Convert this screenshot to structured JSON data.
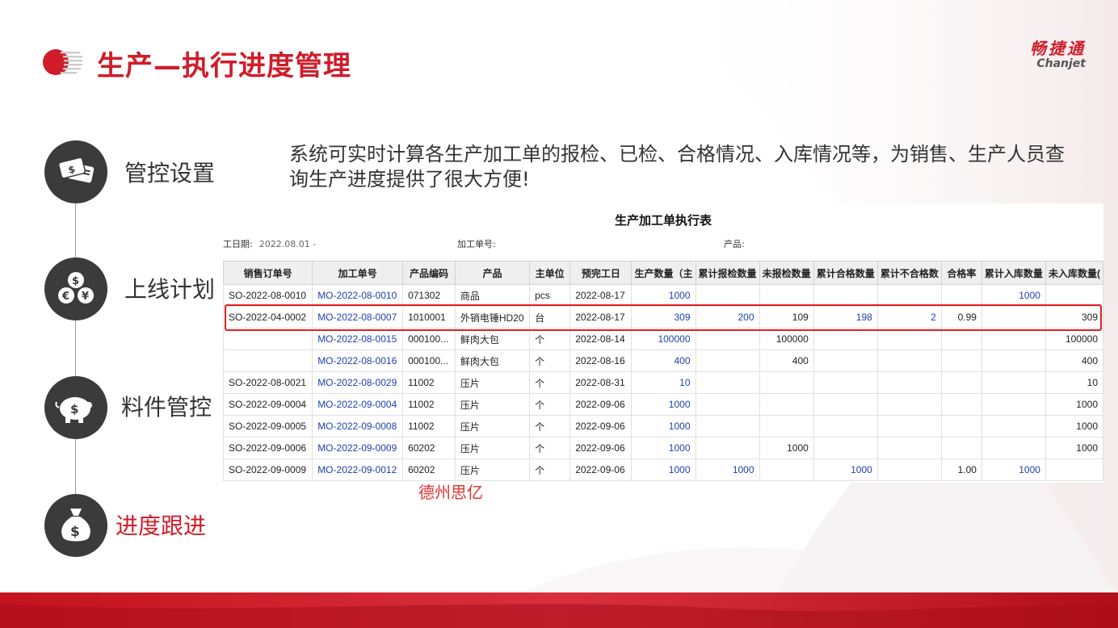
{
  "title": "生产—执行进度管理",
  "brand": {
    "name_cn": "畅捷通",
    "name_en": "Chanjet"
  },
  "colors": {
    "accent": "#d01c2a",
    "nav_circle": "#3b3b3b",
    "link": "#1f3fb0",
    "highlight": "#e02020"
  },
  "nav": [
    {
      "label": "管控设置",
      "icon": "credit-cards-icon",
      "active": false
    },
    {
      "label": "上线计划",
      "icon": "coins-icon",
      "active": false
    },
    {
      "label": "料件管控",
      "icon": "piggy-bank-icon",
      "active": false
    },
    {
      "label": "进度跟进",
      "icon": "money-bag-icon",
      "active": true
    }
  ],
  "description": "系统可实时计算各生产加工单的报检、已检、合格情况、入库情况等，为销售、生产人员查询生产进度提供了很大方便!",
  "report": {
    "title": "生产加工单执行表",
    "filters": [
      {
        "label": "工日期:",
        "value": "2022.08.01 -"
      },
      {
        "label": "加工单号:",
        "value": ""
      },
      {
        "label": "产品:",
        "value": ""
      }
    ],
    "columns": [
      "销售订单号",
      "加工单号",
      "产品编码",
      "产品",
      "主单位",
      "预完工日",
      "生产数量（主",
      "累计报检数量",
      "未报检数量",
      "累计合格数量",
      "累计不合格数",
      "合格率",
      "累计入库数量",
      "未入库数量("
    ],
    "rows": [
      [
        "SO-2022-08-0010",
        "MO-2022-08-0010",
        "071302",
        "商品",
        "pcs",
        "2022-08-17",
        "1000",
        "",
        "",
        "",
        "",
        "",
        "1000",
        ""
      ],
      [
        "SO-2022-04-0002",
        "MO-2022-08-0007",
        "1010001",
        "外销电锤HD20",
        "台",
        "2022-08-17",
        "309",
        "200",
        "109",
        "198",
        "2",
        "0.99",
        "",
        "309"
      ],
      [
        "",
        "MO-2022-08-0015",
        "000100...",
        "鲜肉大包",
        "个",
        "2022-08-14",
        "100000",
        "",
        "100000",
        "",
        "",
        "",
        "",
        "100000"
      ],
      [
        "",
        "MO-2022-08-0016",
        "000100...",
        "鲜肉大包",
        "个",
        "2022-08-16",
        "400",
        "",
        "400",
        "",
        "",
        "",
        "",
        "400"
      ],
      [
        "SO-2022-08-0021",
        "MO-2022-08-0029",
        "11002",
        "压片",
        "个",
        "2022-08-31",
        "10",
        "",
        "",
        "",
        "",
        "",
        "",
        "10"
      ],
      [
        "SO-2022-09-0004",
        "MO-2022-09-0004",
        "11002",
        "压片",
        "个",
        "2022-09-06",
        "1000",
        "",
        "",
        "",
        "",
        "",
        "",
        "1000"
      ],
      [
        "SO-2022-09-0005",
        "MO-2022-09-0008",
        "11002",
        "压片",
        "个",
        "2022-09-06",
        "1000",
        "",
        "",
        "",
        "",
        "",
        "",
        "1000"
      ],
      [
        "SO-2022-09-0006",
        "MO-2022-09-0009",
        "60202",
        "压片",
        "个",
        "2022-09-06",
        "1000",
        "",
        "1000",
        "",
        "",
        "",
        "",
        "1000"
      ],
      [
        "SO-2022-09-0009",
        "MO-2022-09-0012",
        "60202",
        "压片",
        "个",
        "2022-09-06",
        "1000",
        "1000",
        "",
        "1000",
        "",
        "1.00",
        "1000",
        ""
      ]
    ],
    "highlighted_row": 1
  },
  "watermark": "德州思亿"
}
